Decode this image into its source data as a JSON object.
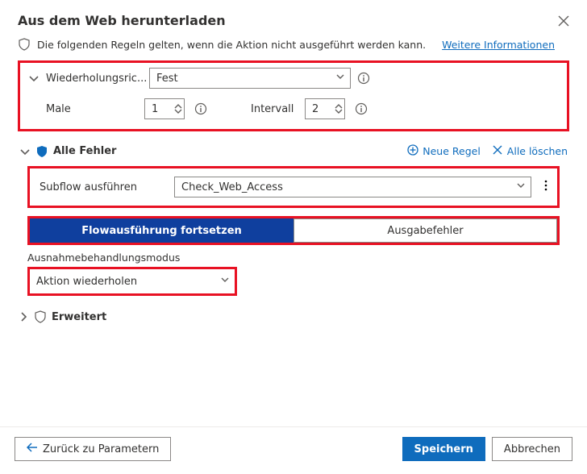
{
  "dialog": {
    "title": "Aus dem Web herunterladen"
  },
  "info": {
    "text": "Die folgenden Regeln gelten, wenn die Aktion nicht ausgeführt werden kann.",
    "link": "Weitere Informationen"
  },
  "retry": {
    "label": "Wiederholungsric...",
    "mode": "Fest",
    "times_label": "Male",
    "times_value": "1",
    "interval_label": "Intervall",
    "interval_value": "2"
  },
  "all_errors": {
    "title": "Alle Fehler",
    "new_rule": "Neue Regel",
    "clear_all": "Alle löschen",
    "subflow_label": "Subflow ausführen",
    "subflow_value": "Check_Web_Access",
    "tabs": {
      "continue": "Flowausführung fortsetzen",
      "output": "Ausgabefehler"
    },
    "mode_label": "Ausnahmebehandlungsmodus",
    "mode_value": "Aktion wiederholen"
  },
  "advanced": {
    "label": "Erweitert"
  },
  "footer": {
    "back": "Zurück zu Parametern",
    "save": "Speichern",
    "cancel": "Abbrechen"
  }
}
